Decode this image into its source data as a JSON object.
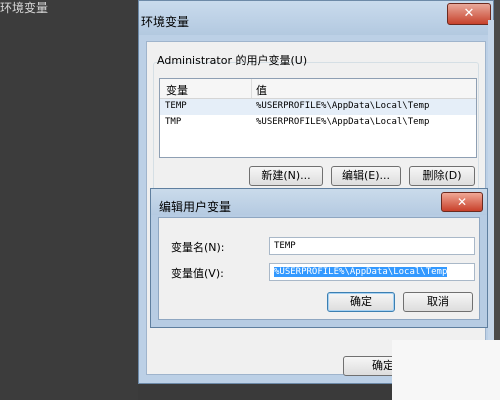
{
  "background": {
    "top_text": "环境变量"
  },
  "env_window": {
    "title": "环境变量",
    "close_glyph": "✕",
    "user_vars_group_label": "Administrator 的用户变量(U)",
    "columns": [
      "变量",
      "值"
    ],
    "rows": [
      {
        "name": "TEMP",
        "value": "%USERPROFILE%\\AppData\\Local\\Temp"
      },
      {
        "name": "TMP",
        "value": "%USERPROFILE%\\AppData\\Local\\Temp"
      }
    ],
    "buttons": {
      "new": "新建(N)...",
      "edit": "编辑(E)...",
      "delete": "删除(D)"
    },
    "ok_label": "确定"
  },
  "edit_dialog": {
    "title": "编辑用户变量",
    "close_glyph": "✕",
    "name_label": "变量名(N):",
    "name_value": "TEMP",
    "value_label": "变量值(V):",
    "value_value": "%USERPROFILE%\\AppData\\Local\\Temp",
    "ok_label": "确定",
    "cancel_label": "取消"
  }
}
